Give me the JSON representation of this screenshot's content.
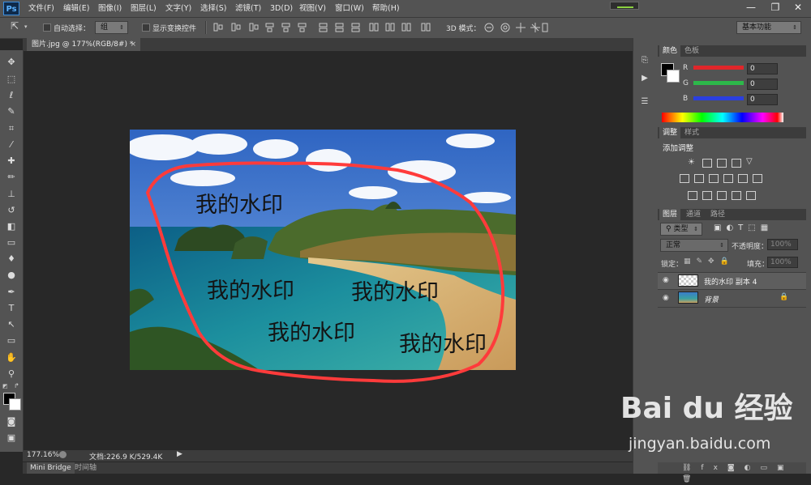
{
  "app": {
    "logo": "Ps"
  },
  "menu": [
    "文件(F)",
    "编辑(E)",
    "图像(I)",
    "图层(L)",
    "文字(Y)",
    "选择(S)",
    "滤镜(T)",
    "3D(D)",
    "视图(V)",
    "窗口(W)",
    "帮助(H)"
  ],
  "window_controls": {
    "minimize": "—",
    "restore": "❐",
    "close": "✕"
  },
  "options": {
    "auto_select_label": "自动选择：",
    "auto_select_value": "组",
    "show_transform_label": "显示变换控件",
    "mode_3d_label": "3D 模式：",
    "workspace": "基本功能"
  },
  "document": {
    "tab_title": "图片.jpg @ 177%(RGB/8#) *",
    "tab_close": "×",
    "watermark_text": "我的水印"
  },
  "status": {
    "zoom": "177.16%",
    "doc_size": "文档:226.9 K/529.4K"
  },
  "bottom_tabs": [
    "Mini Bridge",
    "时间轴"
  ],
  "color_panel": {
    "tabs": [
      "颜色",
      "色板"
    ],
    "channels": [
      {
        "label": "R",
        "value": "0",
        "color": "#e0262a"
      },
      {
        "label": "G",
        "value": "0",
        "color": "#2db84a"
      },
      {
        "label": "B",
        "value": "0",
        "color": "#2b3fe0"
      }
    ]
  },
  "adjust_panel": {
    "tabs": [
      "调整",
      "样式"
    ],
    "title": "添加调整"
  },
  "layers_panel": {
    "tabs": [
      "图层",
      "通道",
      "路径"
    ],
    "filter": "类型",
    "blend_mode": "正常",
    "opacity_label": "不透明度：",
    "opacity_value": "100%",
    "lock_label": "锁定：",
    "fill_label": "填充：",
    "fill_value": "100%",
    "layers": [
      {
        "name": "我的水印 副本 4"
      },
      {
        "name": "背景"
      }
    ]
  },
  "site_watermark": {
    "brand": "Bai du 经验",
    "url": "jingyan.baidu.com"
  }
}
